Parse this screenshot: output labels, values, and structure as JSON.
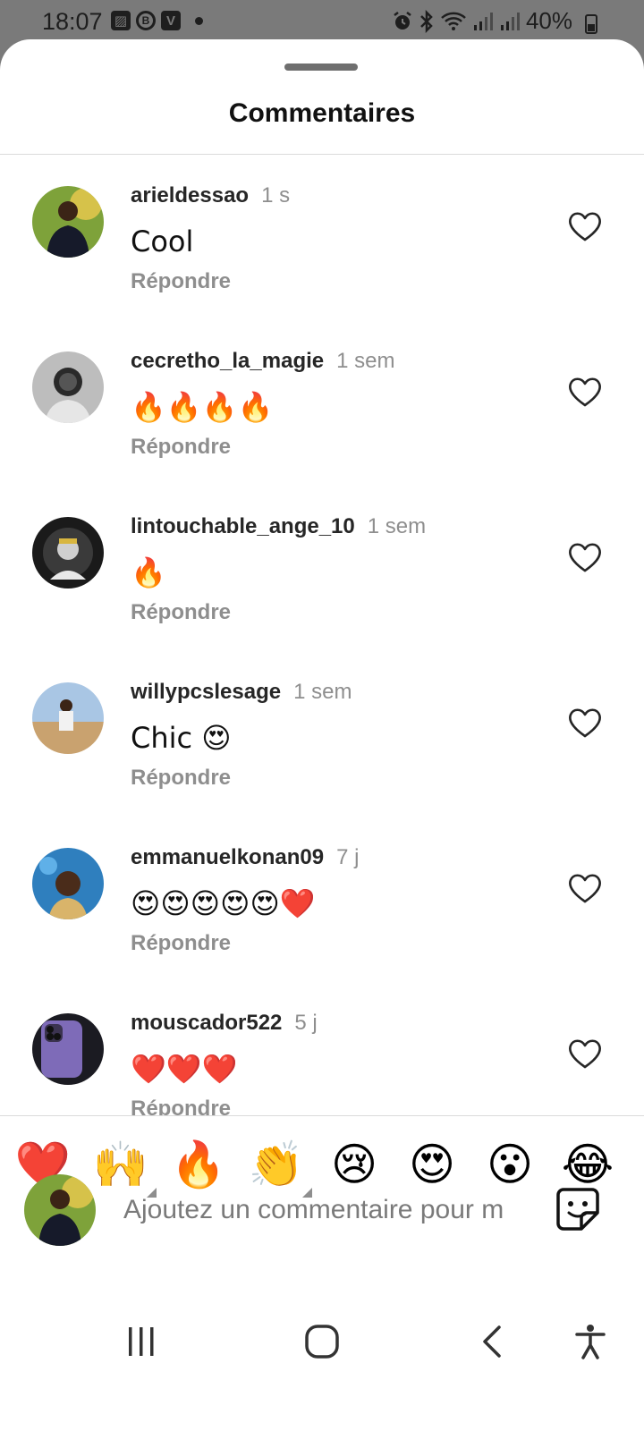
{
  "status_bar": {
    "time": "18:07",
    "battery": "40%",
    "left_icons": [
      "image-icon",
      "bluetooth-b-icon",
      "v-icon",
      "dot-icon"
    ],
    "right_icons": [
      "alarm-icon",
      "bluetooth-icon",
      "wifi-icon",
      "signal-icon",
      "signal-icon",
      "battery-icon"
    ]
  },
  "sheet": {
    "title": "Commentaires"
  },
  "comments": [
    {
      "username": "arieldessao",
      "time": "1 s",
      "text": "Cool",
      "reply_label": "Répondre"
    },
    {
      "username": "cecretho_la_magie",
      "time": "1 sem",
      "text": "🔥🔥🔥🔥",
      "reply_label": "Répondre"
    },
    {
      "username": "lintouchable_ange_10",
      "time": "1 sem",
      "text": "🔥",
      "reply_label": "Répondre"
    },
    {
      "username": "willypcslesage",
      "time": "1 sem",
      "text": "Chic 😍",
      "reply_label": "Répondre"
    },
    {
      "username": "emmanuelkonan09",
      "time": "7 j",
      "text": "😍😍😍😍😍❤️",
      "reply_label": "Répondre"
    },
    {
      "username": "mouscador522",
      "time": "5 j",
      "text": "❤️❤️❤️",
      "reply_label": "Répondre"
    }
  ],
  "reactions": [
    "❤️",
    "🙌",
    "🔥",
    "👏",
    "😢",
    "😍",
    "😮",
    "😂"
  ],
  "composer": {
    "placeholder": "Ajoutez un commentaire pour m"
  },
  "colors": {
    "heart_red": "#ed1c24",
    "muted_text": "#8e8e8e",
    "status_bar_bg": "#7a7a7a"
  }
}
